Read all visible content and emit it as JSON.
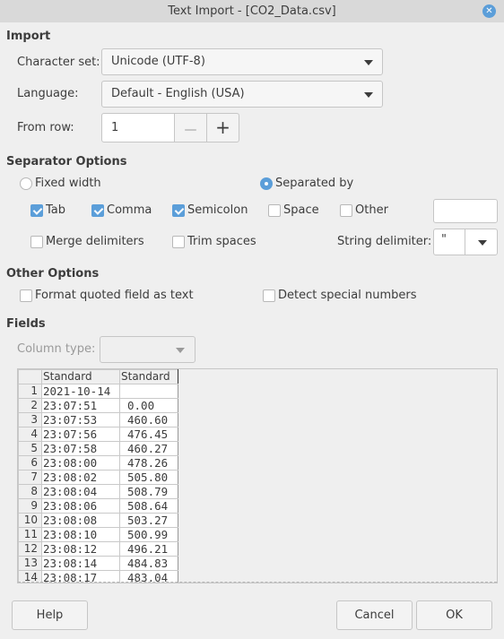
{
  "window": {
    "title": "Text Import - [CO2_Data.csv]",
    "close_icon": "close-icon"
  },
  "import": {
    "heading": "Import",
    "charset_label": "Character set:",
    "charset_value": "Unicode (UTF-8)",
    "language_label": "Language:",
    "language_value": "Default - English (USA)",
    "from_row_label": "From row:",
    "from_row_value": "1",
    "minus_glyph": "—",
    "plus_glyph": "+"
  },
  "separator": {
    "heading": "Separator Options",
    "fixed_width_label": "Fixed width",
    "fixed_width_selected": false,
    "separated_by_label": "Separated by",
    "separated_by_selected": true,
    "tab_label": "Tab",
    "tab_checked": true,
    "comma_label": "Comma",
    "comma_checked": true,
    "semicolon_label": "Semicolon",
    "semicolon_checked": true,
    "space_label": "Space",
    "space_checked": false,
    "other_label": "Other",
    "other_checked": false,
    "other_value": "",
    "merge_label": "Merge delimiters",
    "merge_checked": false,
    "trim_label": "Trim spaces",
    "trim_checked": false,
    "string_delim_label": "String delimiter:",
    "string_delim_value": "\""
  },
  "other_options": {
    "heading": "Other Options",
    "quoted_label": "Format quoted field as text",
    "quoted_checked": false,
    "special_label": "Detect special numbers",
    "special_checked": false
  },
  "fields": {
    "heading": "Fields",
    "column_type_label": "Column type:",
    "column_type_value": ""
  },
  "preview": {
    "headers": [
      "Standard",
      "Standard"
    ],
    "rows": [
      {
        "n": "1",
        "a": "2021-10-14",
        "b": ""
      },
      {
        "n": "2",
        "a": "23:07:51",
        "b": "0.00"
      },
      {
        "n": "3",
        "a": "23:07:53",
        "b": "460.60"
      },
      {
        "n": "4",
        "a": "23:07:56",
        "b": "476.45"
      },
      {
        "n": "5",
        "a": "23:07:58",
        "b": "460.27"
      },
      {
        "n": "6",
        "a": "23:08:00",
        "b": "478.26"
      },
      {
        "n": "7",
        "a": "23:08:02",
        "b": "505.80"
      },
      {
        "n": "8",
        "a": "23:08:04",
        "b": "508.79"
      },
      {
        "n": "9",
        "a": "23:08:06",
        "b": "508.64"
      },
      {
        "n": "10",
        "a": "23:08:08",
        "b": "503.27"
      },
      {
        "n": "11",
        "a": "23:08:10",
        "b": "500.99"
      },
      {
        "n": "12",
        "a": "23:08:12",
        "b": "496.21"
      },
      {
        "n": "13",
        "a": "23:08:14",
        "b": "484.83"
      },
      {
        "n": "14",
        "a": "23:08:17",
        "b": "483.04"
      }
    ]
  },
  "buttons": {
    "help": "Help",
    "cancel": "Cancel",
    "ok": "OK"
  }
}
